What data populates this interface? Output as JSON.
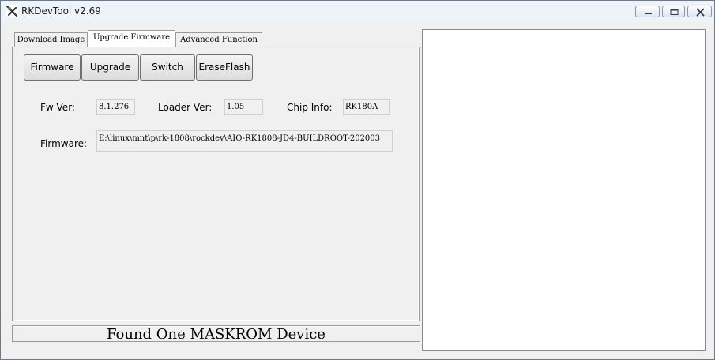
{
  "window": {
    "title": "RKDevTool v2.69"
  },
  "tabs": [
    {
      "label": "Download Image",
      "selected": false
    },
    {
      "label": "Upgrade Firmware",
      "selected": true
    },
    {
      "label": "Advanced Function",
      "selected": false
    }
  ],
  "toolbar": {
    "firmware_label": "Firmware",
    "upgrade_label": "Upgrade",
    "switch_label": "Switch",
    "eraseflash_label": "EraseFlash"
  },
  "info": {
    "fw_ver_label": "Fw Ver:",
    "fw_ver_value": "8.1.276",
    "loader_ver_label": "Loader Ver:",
    "loader_ver_value": "1.05",
    "chip_info_label": "Chip Info:",
    "chip_info_value": "RK180A",
    "firmware_label": "Firmware:",
    "firmware_path": "E:\\linux\\mnt\\p\\rk-1808\\rockdev\\AIO-RK1808-JD4-BUILDROOT-202003"
  },
  "status": {
    "text": "Found One MASKROM Device"
  },
  "icons": {
    "app": "rockchip-tool-icon",
    "minimize": "minimize-icon",
    "maximize": "maximize-icon",
    "close": "close-icon"
  }
}
